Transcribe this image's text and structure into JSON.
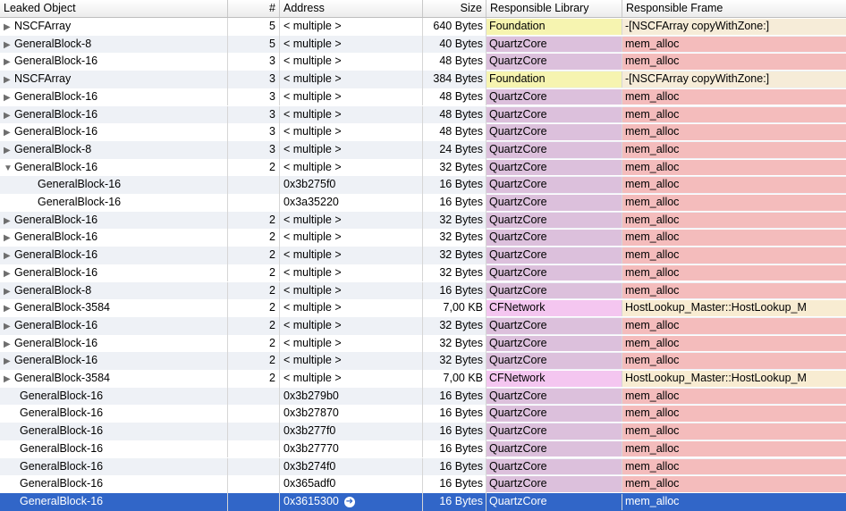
{
  "columns": {
    "leaked_object": "Leaked Object",
    "count": "#",
    "address": "Address",
    "size": "Size",
    "responsible_library": "Responsible Library",
    "responsible_frame": "Responsible Frame"
  },
  "library_colors": {
    "Foundation": "#f6f4b0",
    "QuartzCore": "#dcc0dc",
    "CFNetwork": "#f4c6f0"
  },
  "frame_colors": {
    "copy": "#f6ecd8",
    "mem_alloc": "#f4bcbc",
    "hostlookup": "#f8ecd2"
  },
  "selected_color": "#3166c8",
  "rows": [
    {
      "name": "NSCFArray",
      "disclosure": "collapsed",
      "count": "5",
      "address": "< multiple >",
      "size": "640 Bytes",
      "library": "Foundation",
      "frame": "-[NSCFArray copyWithZone:]",
      "frame_kind": "copy"
    },
    {
      "name": "GeneralBlock-8",
      "disclosure": "collapsed",
      "count": "5",
      "address": "< multiple >",
      "size": "40 Bytes",
      "library": "QuartzCore",
      "frame": "mem_alloc",
      "frame_kind": "mem_alloc"
    },
    {
      "name": "GeneralBlock-16",
      "disclosure": "collapsed",
      "count": "3",
      "address": "< multiple >",
      "size": "48 Bytes",
      "library": "QuartzCore",
      "frame": "mem_alloc",
      "frame_kind": "mem_alloc"
    },
    {
      "name": "NSCFArray",
      "disclosure": "collapsed",
      "count": "3",
      "address": "< multiple >",
      "size": "384 Bytes",
      "library": "Foundation",
      "frame": "-[NSCFArray copyWithZone:]",
      "frame_kind": "copy"
    },
    {
      "name": "GeneralBlock-16",
      "disclosure": "collapsed",
      "count": "3",
      "address": "< multiple >",
      "size": "48 Bytes",
      "library": "QuartzCore",
      "frame": "mem_alloc",
      "frame_kind": "mem_alloc"
    },
    {
      "name": "GeneralBlock-16",
      "disclosure": "collapsed",
      "count": "3",
      "address": "< multiple >",
      "size": "48 Bytes",
      "library": "QuartzCore",
      "frame": "mem_alloc",
      "frame_kind": "mem_alloc"
    },
    {
      "name": "GeneralBlock-16",
      "disclosure": "collapsed",
      "count": "3",
      "address": "< multiple >",
      "size": "48 Bytes",
      "library": "QuartzCore",
      "frame": "mem_alloc",
      "frame_kind": "mem_alloc"
    },
    {
      "name": "GeneralBlock-8",
      "disclosure": "collapsed",
      "count": "3",
      "address": "< multiple >",
      "size": "24 Bytes",
      "library": "QuartzCore",
      "frame": "mem_alloc",
      "frame_kind": "mem_alloc"
    },
    {
      "name": "GeneralBlock-16",
      "disclosure": "expanded",
      "count": "2",
      "address": "< multiple >",
      "size": "32 Bytes",
      "library": "QuartzCore",
      "frame": "mem_alloc",
      "frame_kind": "mem_alloc"
    },
    {
      "name": "GeneralBlock-16",
      "disclosure": "child",
      "count": "",
      "address": "0x3b275f0",
      "size": "16 Bytes",
      "library": "QuartzCore",
      "frame": "mem_alloc",
      "frame_kind": "mem_alloc"
    },
    {
      "name": "GeneralBlock-16",
      "disclosure": "child",
      "count": "",
      "address": "0x3a35220",
      "size": "16 Bytes",
      "library": "QuartzCore",
      "frame": "mem_alloc",
      "frame_kind": "mem_alloc"
    },
    {
      "name": "GeneralBlock-16",
      "disclosure": "collapsed",
      "count": "2",
      "address": "< multiple >",
      "size": "32 Bytes",
      "library": "QuartzCore",
      "frame": "mem_alloc",
      "frame_kind": "mem_alloc"
    },
    {
      "name": "GeneralBlock-16",
      "disclosure": "collapsed",
      "count": "2",
      "address": "< multiple >",
      "size": "32 Bytes",
      "library": "QuartzCore",
      "frame": "mem_alloc",
      "frame_kind": "mem_alloc"
    },
    {
      "name": "GeneralBlock-16",
      "disclosure": "collapsed",
      "count": "2",
      "address": "< multiple >",
      "size": "32 Bytes",
      "library": "QuartzCore",
      "frame": "mem_alloc",
      "frame_kind": "mem_alloc"
    },
    {
      "name": "GeneralBlock-16",
      "disclosure": "collapsed",
      "count": "2",
      "address": "< multiple >",
      "size": "32 Bytes",
      "library": "QuartzCore",
      "frame": "mem_alloc",
      "frame_kind": "mem_alloc"
    },
    {
      "name": "GeneralBlock-8",
      "disclosure": "collapsed",
      "count": "2",
      "address": "< multiple >",
      "size": "16 Bytes",
      "library": "QuartzCore",
      "frame": "mem_alloc",
      "frame_kind": "mem_alloc"
    },
    {
      "name": "GeneralBlock-3584",
      "disclosure": "collapsed",
      "count": "2",
      "address": "< multiple >",
      "size": "7,00 KB",
      "library": "CFNetwork",
      "frame": "HostLookup_Master::HostLookup_M",
      "frame_kind": "hostlookup"
    },
    {
      "name": "GeneralBlock-16",
      "disclosure": "collapsed",
      "count": "2",
      "address": "< multiple >",
      "size": "32 Bytes",
      "library": "QuartzCore",
      "frame": "mem_alloc",
      "frame_kind": "mem_alloc"
    },
    {
      "name": "GeneralBlock-16",
      "disclosure": "collapsed",
      "count": "2",
      "address": "< multiple >",
      "size": "32 Bytes",
      "library": "QuartzCore",
      "frame": "mem_alloc",
      "frame_kind": "mem_alloc"
    },
    {
      "name": "GeneralBlock-16",
      "disclosure": "collapsed",
      "count": "2",
      "address": "< multiple >",
      "size": "32 Bytes",
      "library": "QuartzCore",
      "frame": "mem_alloc",
      "frame_kind": "mem_alloc"
    },
    {
      "name": "GeneralBlock-3584",
      "disclosure": "collapsed",
      "count": "2",
      "address": "< multiple >",
      "size": "7,00 KB",
      "library": "CFNetwork",
      "frame": "HostLookup_Master::HostLookup_M",
      "frame_kind": "hostlookup"
    },
    {
      "name": "GeneralBlock-16",
      "disclosure": "none",
      "count": "",
      "address": "0x3b279b0",
      "size": "16 Bytes",
      "library": "QuartzCore",
      "frame": "mem_alloc",
      "frame_kind": "mem_alloc"
    },
    {
      "name": "GeneralBlock-16",
      "disclosure": "none",
      "count": "",
      "address": "0x3b27870",
      "size": "16 Bytes",
      "library": "QuartzCore",
      "frame": "mem_alloc",
      "frame_kind": "mem_alloc"
    },
    {
      "name": "GeneralBlock-16",
      "disclosure": "none",
      "count": "",
      "address": "0x3b277f0",
      "size": "16 Bytes",
      "library": "QuartzCore",
      "frame": "mem_alloc",
      "frame_kind": "mem_alloc"
    },
    {
      "name": "GeneralBlock-16",
      "disclosure": "none",
      "count": "",
      "address": "0x3b27770",
      "size": "16 Bytes",
      "library": "QuartzCore",
      "frame": "mem_alloc",
      "frame_kind": "mem_alloc"
    },
    {
      "name": "GeneralBlock-16",
      "disclosure": "none",
      "count": "",
      "address": "0x3b274f0",
      "size": "16 Bytes",
      "library": "QuartzCore",
      "frame": "mem_alloc",
      "frame_kind": "mem_alloc"
    },
    {
      "name": "GeneralBlock-16",
      "disclosure": "none",
      "count": "",
      "address": "0x365adf0",
      "size": "16 Bytes",
      "library": "QuartzCore",
      "frame": "mem_alloc",
      "frame_kind": "mem_alloc"
    },
    {
      "name": "GeneralBlock-16",
      "disclosure": "none",
      "count": "",
      "address": "0x3615300",
      "size": "16 Bytes",
      "library": "QuartzCore",
      "frame": "mem_alloc",
      "frame_kind": "mem_alloc",
      "selected": true,
      "address_icon": "go-arrow-icon"
    }
  ]
}
